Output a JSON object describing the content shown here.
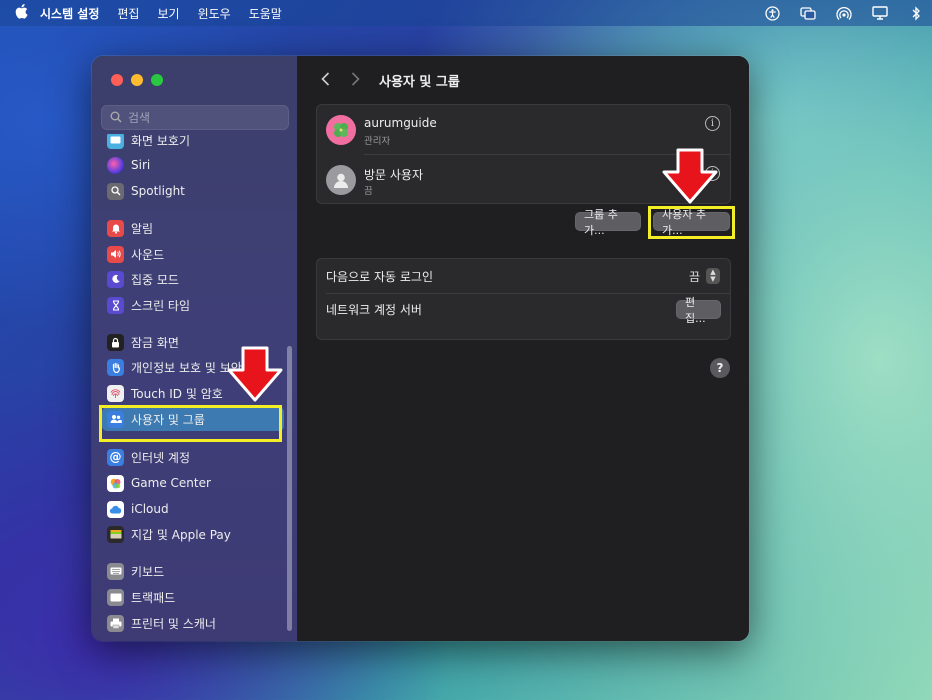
{
  "menubar": {
    "app_name": "시스템 설정",
    "items": [
      "편집",
      "보기",
      "윈도우",
      "도움말"
    ],
    "status_icons": [
      "accessibility-icon",
      "screen-mirroring-icon",
      "airdrop-icon",
      "display-icon",
      "bluetooth-icon"
    ]
  },
  "sidebar": {
    "search_placeholder": "검색",
    "items": [
      {
        "label": "화면 보호기",
        "icon": "screensaver-icon",
        "color": "#4ab0e0"
      },
      {
        "label": "Siri",
        "icon": "siri-icon",
        "color": "#8a3fd0"
      },
      {
        "label": "Spotlight",
        "icon": "spotlight-icon",
        "color": "#6a6a70"
      },
      {
        "label": "알림",
        "icon": "bell-icon",
        "color": "#e84a4a"
      },
      {
        "label": "사운드",
        "icon": "speaker-icon",
        "color": "#e84a4a"
      },
      {
        "label": "집중 모드",
        "icon": "moon-icon",
        "color": "#5a4ad0"
      },
      {
        "label": "스크린 타임",
        "icon": "hourglass-icon",
        "color": "#5a4ad0"
      },
      {
        "label": "잠금 화면",
        "icon": "lock-icon",
        "color": "#222222"
      },
      {
        "label": "개인정보 보호 및 보안",
        "icon": "hand-icon",
        "color": "#3a7ee0"
      },
      {
        "label": "Touch ID 및 암호",
        "icon": "fingerprint-icon",
        "color": "#f0f0f0"
      },
      {
        "label": "사용자 및 그룹",
        "icon": "users-icon",
        "color": "#3a7ee0"
      },
      {
        "label": "인터넷 계정",
        "icon": "at-icon",
        "color": "#3a7ee0"
      },
      {
        "label": "Game Center",
        "icon": "game-center-icon",
        "color": "#ffffff"
      },
      {
        "label": "iCloud",
        "icon": "cloud-icon",
        "color": "#ffffff"
      },
      {
        "label": "지갑 및 Apple Pay",
        "icon": "wallet-icon",
        "color": "#2a2a2a"
      },
      {
        "label": "키보드",
        "icon": "keyboard-icon",
        "color": "#8a8a90"
      },
      {
        "label": "트랙패드",
        "icon": "trackpad-icon",
        "color": "#8a8a90"
      },
      {
        "label": "프린터 및 스캐너",
        "icon": "printer-icon",
        "color": "#8a8a90"
      }
    ]
  },
  "main": {
    "title": "사용자 및 그룹",
    "users": [
      {
        "name": "aurumguide",
        "role": "관리자"
      },
      {
        "name": "방문 사용자",
        "role": "끔"
      }
    ],
    "add_group_label": "그룹 추가...",
    "add_user_label": "사용자 추가...",
    "auto_login_label": "다음으로 자동 로그인",
    "auto_login_value": "끔",
    "network_server_label": "네트워크 계정 서버",
    "edit_label": "편집...",
    "help_label": "?"
  },
  "colors": {
    "highlight": "#f4ee26",
    "arrow": "#e8141b",
    "selected": "#3d7ab1"
  }
}
